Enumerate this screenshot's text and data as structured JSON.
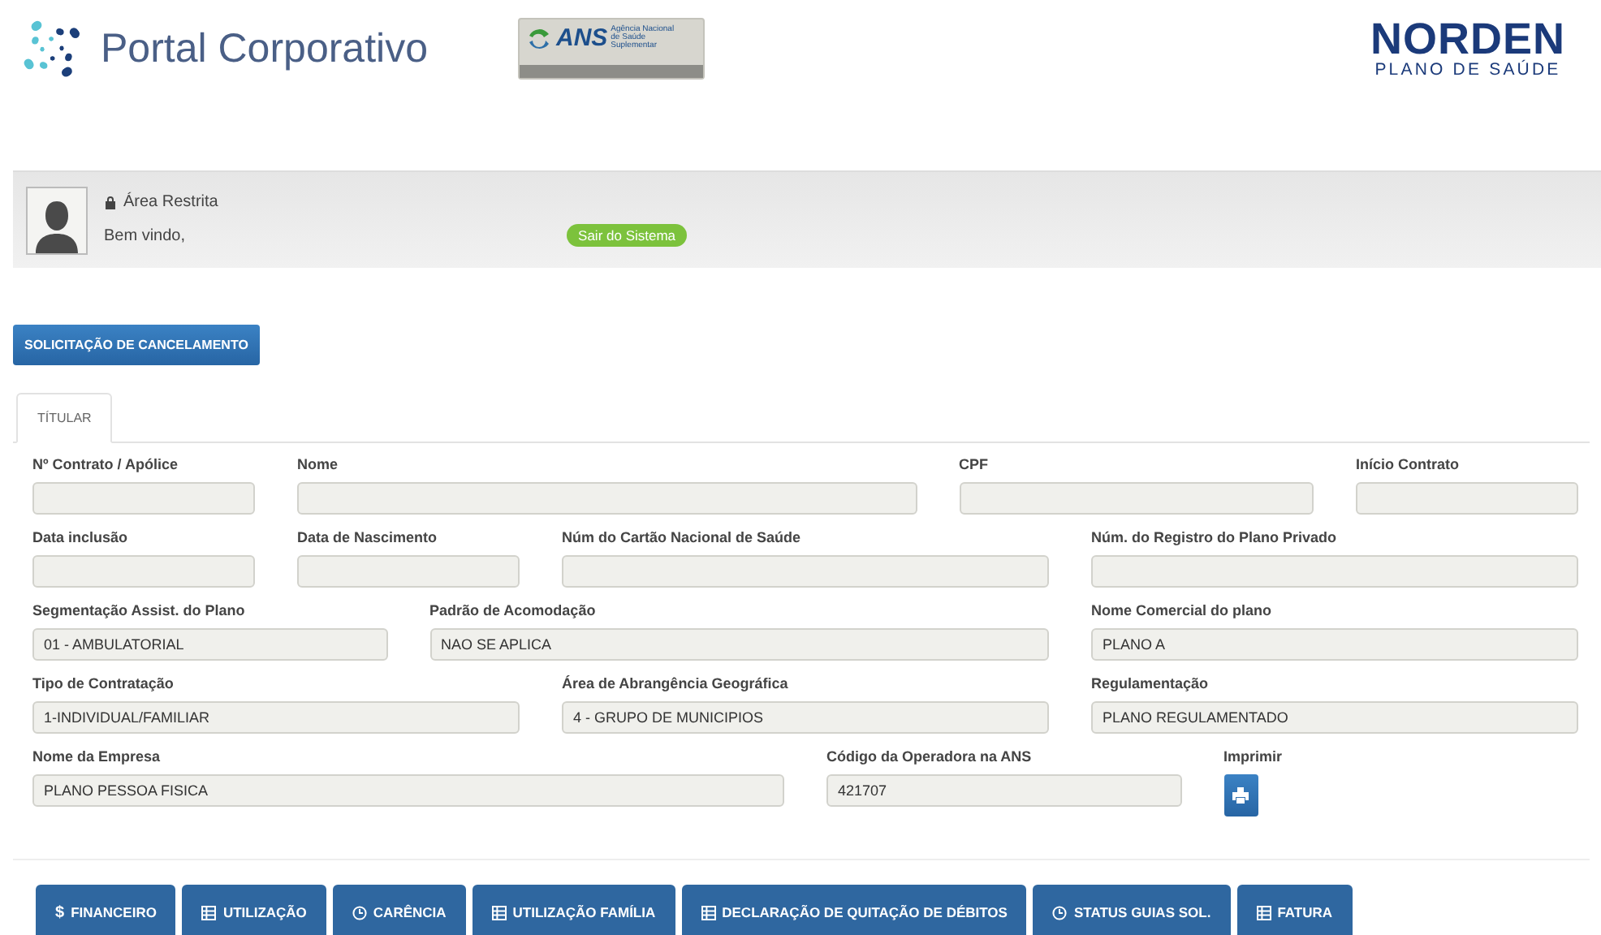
{
  "header": {
    "portal_title": "Portal Corporativo",
    "ans_logo": {
      "acronym": "ANS",
      "subtitle": "Agência Nacional de Saúde Suplementar"
    },
    "brand": {
      "name": "NORDEN",
      "tagline": "PLANO DE SAÚDE"
    }
  },
  "user_panel": {
    "area": "Área Restrita",
    "greeting": "Bem vindo,",
    "logout_button": "Sair do Sistema"
  },
  "action_button": "SOLICITAÇÃO DE CANCELAMENTO",
  "tabs": [
    {
      "label": "TÍTULAR",
      "selected": true
    }
  ],
  "form_rows": [
    [
      {
        "kind": "text",
        "label": "Nº Contrato / Apólice"
      },
      {
        "kind": "text",
        "label": "Nome"
      },
      {
        "kind": "text",
        "label": "CPF"
      },
      {
        "kind": "text",
        "label": "Início Contrato"
      }
    ],
    [
      {
        "kind": "text",
        "label": "Data inclusão"
      },
      {
        "kind": "text",
        "label": "Data de Nascimento"
      },
      {
        "kind": "text",
        "label": "Núm do Cartão Nacional de Saúde"
      },
      {
        "kind": "text",
        "label": "Núm. do Registro do Plano Privado"
      }
    ],
    [
      {
        "kind": "text",
        "label": "Segmentação Assist. do Plano",
        "value": "01 - AMBULATORIAL"
      },
      {
        "kind": "text",
        "label": "Padrão de Acomodação",
        "value": "NAO SE APLICA"
      },
      {
        "kind": "text",
        "label": "Nome Comercial do plano",
        "value": "PLANO A"
      }
    ],
    [
      {
        "kind": "text",
        "label": "Tipo de Contratação",
        "value": "1-INDIVIDUAL/FAMILIAR"
      },
      {
        "kind": "text",
        "label": "Área de Abrangência Geográfica",
        "value": "4 - GRUPO DE MUNICIPIOS"
      },
      {
        "kind": "text",
        "label": "Regulamentação",
        "value": "PLANO REGULAMENTADO"
      }
    ],
    [
      {
        "kind": "text",
        "label": "Nome da Empresa",
        "value": "PLANO PESSOA FISICA"
      },
      {
        "kind": "text",
        "label": "Código da Operadora na ANS",
        "value": "421707"
      },
      {
        "kind": "print",
        "label": "Imprimir"
      }
    ]
  ],
  "bottom_tabs": [
    {
      "kind": "dollar",
      "symbol": "$",
      "label": "FINANCEIRO"
    },
    {
      "kind": "table",
      "label": "UTILIZAÇÃO"
    },
    {
      "kind": "clock",
      "label": "CARÊNCIA"
    },
    {
      "kind": "table",
      "label": "UTILIZAÇÃO FAMÍLIA"
    },
    {
      "kind": "table",
      "label": "DECLARAÇÃO DE QUITAÇÃO DE DÉBITOS"
    },
    {
      "kind": "clock",
      "label": "STATUS GUIAS SOL."
    },
    {
      "kind": "table",
      "label": "FATURA"
    }
  ]
}
